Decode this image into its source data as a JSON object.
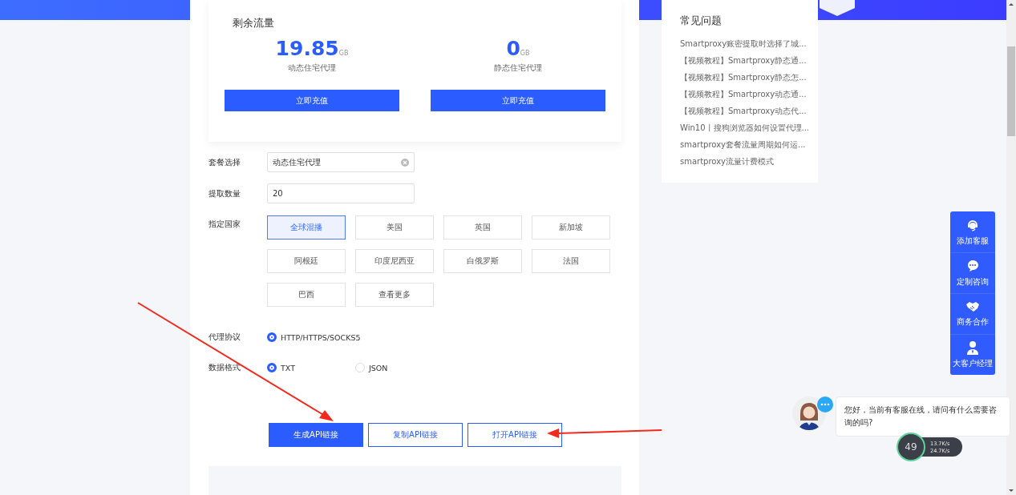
{
  "traffic": {
    "title": "剩余流量",
    "items": [
      {
        "amount": "19.85",
        "unit": "GB",
        "label": "动态住宅代理",
        "button": "立即充值"
      },
      {
        "amount": "0",
        "unit": "GB",
        "label": "静态住宅代理",
        "button": "立即充值"
      }
    ]
  },
  "form": {
    "package": {
      "label": "套餐选择",
      "value": "动态住宅代理"
    },
    "quantity": {
      "label": "提取数量",
      "value": "20"
    },
    "country": {
      "label": "指定国家",
      "options": [
        {
          "label": "全球混播",
          "selected": true
        },
        {
          "label": "美国",
          "selected": false
        },
        {
          "label": "英国",
          "selected": false
        },
        {
          "label": "新加坡",
          "selected": false
        },
        {
          "label": "阿根廷",
          "selected": false
        },
        {
          "label": "印度尼西亚",
          "selected": false
        },
        {
          "label": "白俄罗斯",
          "selected": false
        },
        {
          "label": "法国",
          "selected": false
        },
        {
          "label": "巴西",
          "selected": false
        },
        {
          "label": "查看更多",
          "selected": false
        }
      ]
    },
    "protocol": {
      "label": "代理协议",
      "options": [
        {
          "label": "HTTP/HTTPS/SOCKS5",
          "selected": true
        }
      ]
    },
    "format": {
      "label": "数据格式",
      "options": [
        {
          "label": "TXT",
          "selected": true
        },
        {
          "label": "JSON",
          "selected": false
        }
      ]
    }
  },
  "actions": [
    {
      "label": "生成API链接",
      "kind": "primary"
    },
    {
      "label": "复制API链接",
      "kind": "outline"
    },
    {
      "label": "打开API链接",
      "kind": "outline"
    }
  ],
  "faq": {
    "title": "常见问题",
    "items": [
      "Smartproxy账密提取时选择了城...",
      "【视频教程】Smartproxy静态通...",
      "【视频教程】Smartproxy静态怎...",
      "【视频教程】Smartproxy动态通...",
      "【视频教程】Smartproxy动态代...",
      "Win10丨搜狗浏览器如何设置代理...",
      "smartproxy套餐流量周期如何运...",
      "smartproxy流量计费模式"
    ]
  },
  "float_menu": [
    {
      "label": "添加客服",
      "kind": "headset"
    },
    {
      "label": "定制咨询",
      "kind": "chat"
    },
    {
      "label": "商务合作",
      "kind": "handshake"
    },
    {
      "label": "大客户经理",
      "kind": "manager"
    }
  ],
  "chat": {
    "message": "您好，当前有客服在线，请问有什么需要咨询的吗?"
  },
  "speed_widget": {
    "percent": "49",
    "up": "13.7K/s",
    "down": "24.7K/s"
  }
}
